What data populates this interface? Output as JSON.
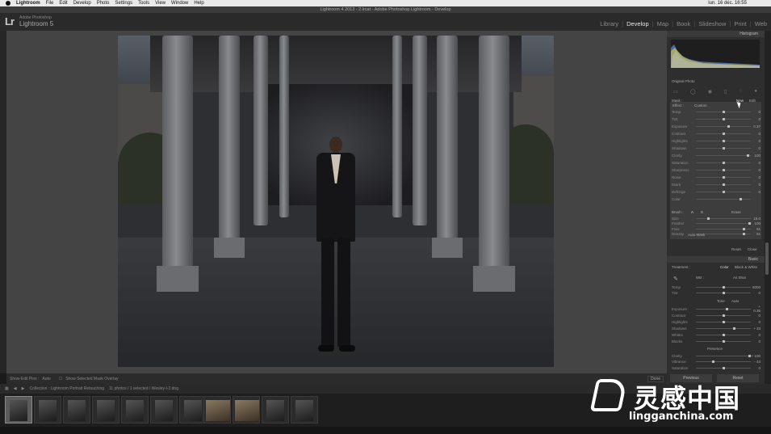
{
  "menubar": {
    "app": "Lightroom",
    "items": [
      "File",
      "Edit",
      "Develop",
      "Photo",
      "Settings",
      "Tools",
      "View",
      "Window",
      "Help"
    ],
    "clock": "lun. 16 déc. 16:55"
  },
  "window": {
    "title": "Lightroom 4 2013 - 2.lrcat - Adobe Photoshop Lightroom - Develop"
  },
  "identity": {
    "logo": "Lr",
    "brand_small": "Adobe Photoshop",
    "brand": "Lightroom 5"
  },
  "modules": [
    {
      "label": "Library",
      "active": false
    },
    {
      "label": "Develop",
      "active": true
    },
    {
      "label": "Map",
      "active": false
    },
    {
      "label": "Book",
      "active": false
    },
    {
      "label": "Slideshow",
      "active": false
    },
    {
      "label": "Print",
      "active": false
    },
    {
      "label": "Web",
      "active": false
    }
  ],
  "right_panel": {
    "histogram_label": "Histogram",
    "original_photo": "Original Photo",
    "mask_label": "Mask :",
    "mask_new": "New",
    "mask_edit": "Edit",
    "effect_label": "Effect :",
    "effect_value": "Custom",
    "sliders": [
      {
        "label": "Temp",
        "value": "0"
      },
      {
        "label": "Tint",
        "value": "0"
      },
      {
        "label": "Exposure",
        "value": "0.37"
      },
      {
        "label": "Contrast",
        "value": "0"
      },
      {
        "label": "Highlights",
        "value": "0"
      },
      {
        "label": "Shadows",
        "value": "0"
      },
      {
        "label": "Clarity",
        "value": "100"
      },
      {
        "label": "Saturation",
        "value": "0"
      },
      {
        "label": "Sharpness",
        "value": "0"
      },
      {
        "label": "Noise",
        "value": "0"
      },
      {
        "label": "Moiré",
        "value": "0"
      },
      {
        "label": "Defringe",
        "value": "0"
      },
      {
        "label": "Color",
        "value": ""
      }
    ],
    "brush_label": "Brush :",
    "brush_a": "A",
    "brush_b": "B",
    "brush_erase": "Erase",
    "brush_sliders": [
      {
        "label": "Size",
        "value": "19.0"
      },
      {
        "label": "Feather",
        "value": "100"
      },
      {
        "label": "Flow",
        "value": "91"
      },
      {
        "label": "Density",
        "value": "91"
      }
    ],
    "auto_mask": "Auto Mask",
    "reset": "Reset",
    "close": "Close",
    "basic_label": "Basic",
    "treatment_label": "Treatment :",
    "treatment_color": "Color",
    "treatment_bw": "Black & White",
    "wb_label": "WB :",
    "wb_value": "As Shot",
    "wb_sliders": [
      {
        "label": "Temp",
        "value": "5000"
      },
      {
        "label": "Tint",
        "value": "0"
      }
    ],
    "tone_label": "Tone",
    "tone_auto": "Auto",
    "tone_sliders": [
      {
        "label": "Exposure",
        "value": "+ 0.35"
      },
      {
        "label": "Contrast",
        "value": "0"
      },
      {
        "label": "Highlights",
        "value": "0"
      },
      {
        "label": "Shadows",
        "value": "+ 33"
      },
      {
        "label": "Whites",
        "value": "0"
      },
      {
        "label": "Blacks",
        "value": "0"
      }
    ],
    "presence_label": "Presence",
    "presence_sliders": [
      {
        "label": "Clarity",
        "value": "+ 100"
      },
      {
        "label": "Vibrance",
        "value": "- 44"
      },
      {
        "label": "Saturation",
        "value": "0"
      }
    ],
    "previous": "Previous",
    "reset_main": "Reset"
  },
  "toolbar": {
    "show_edit_pins": "Show Edit Pins :",
    "edit_pins_value": "Auto",
    "show_overlay": "Show Selected Mask Overlay",
    "done": "Done"
  },
  "filmstrip_bar": {
    "collection": "Collection : Lightroom Portrait Retouching",
    "count": "11 photos / 1 selected / Wesley-l-2.dng"
  },
  "watermark": {
    "cn": "灵感中国",
    "url": "lingganchina.com"
  }
}
